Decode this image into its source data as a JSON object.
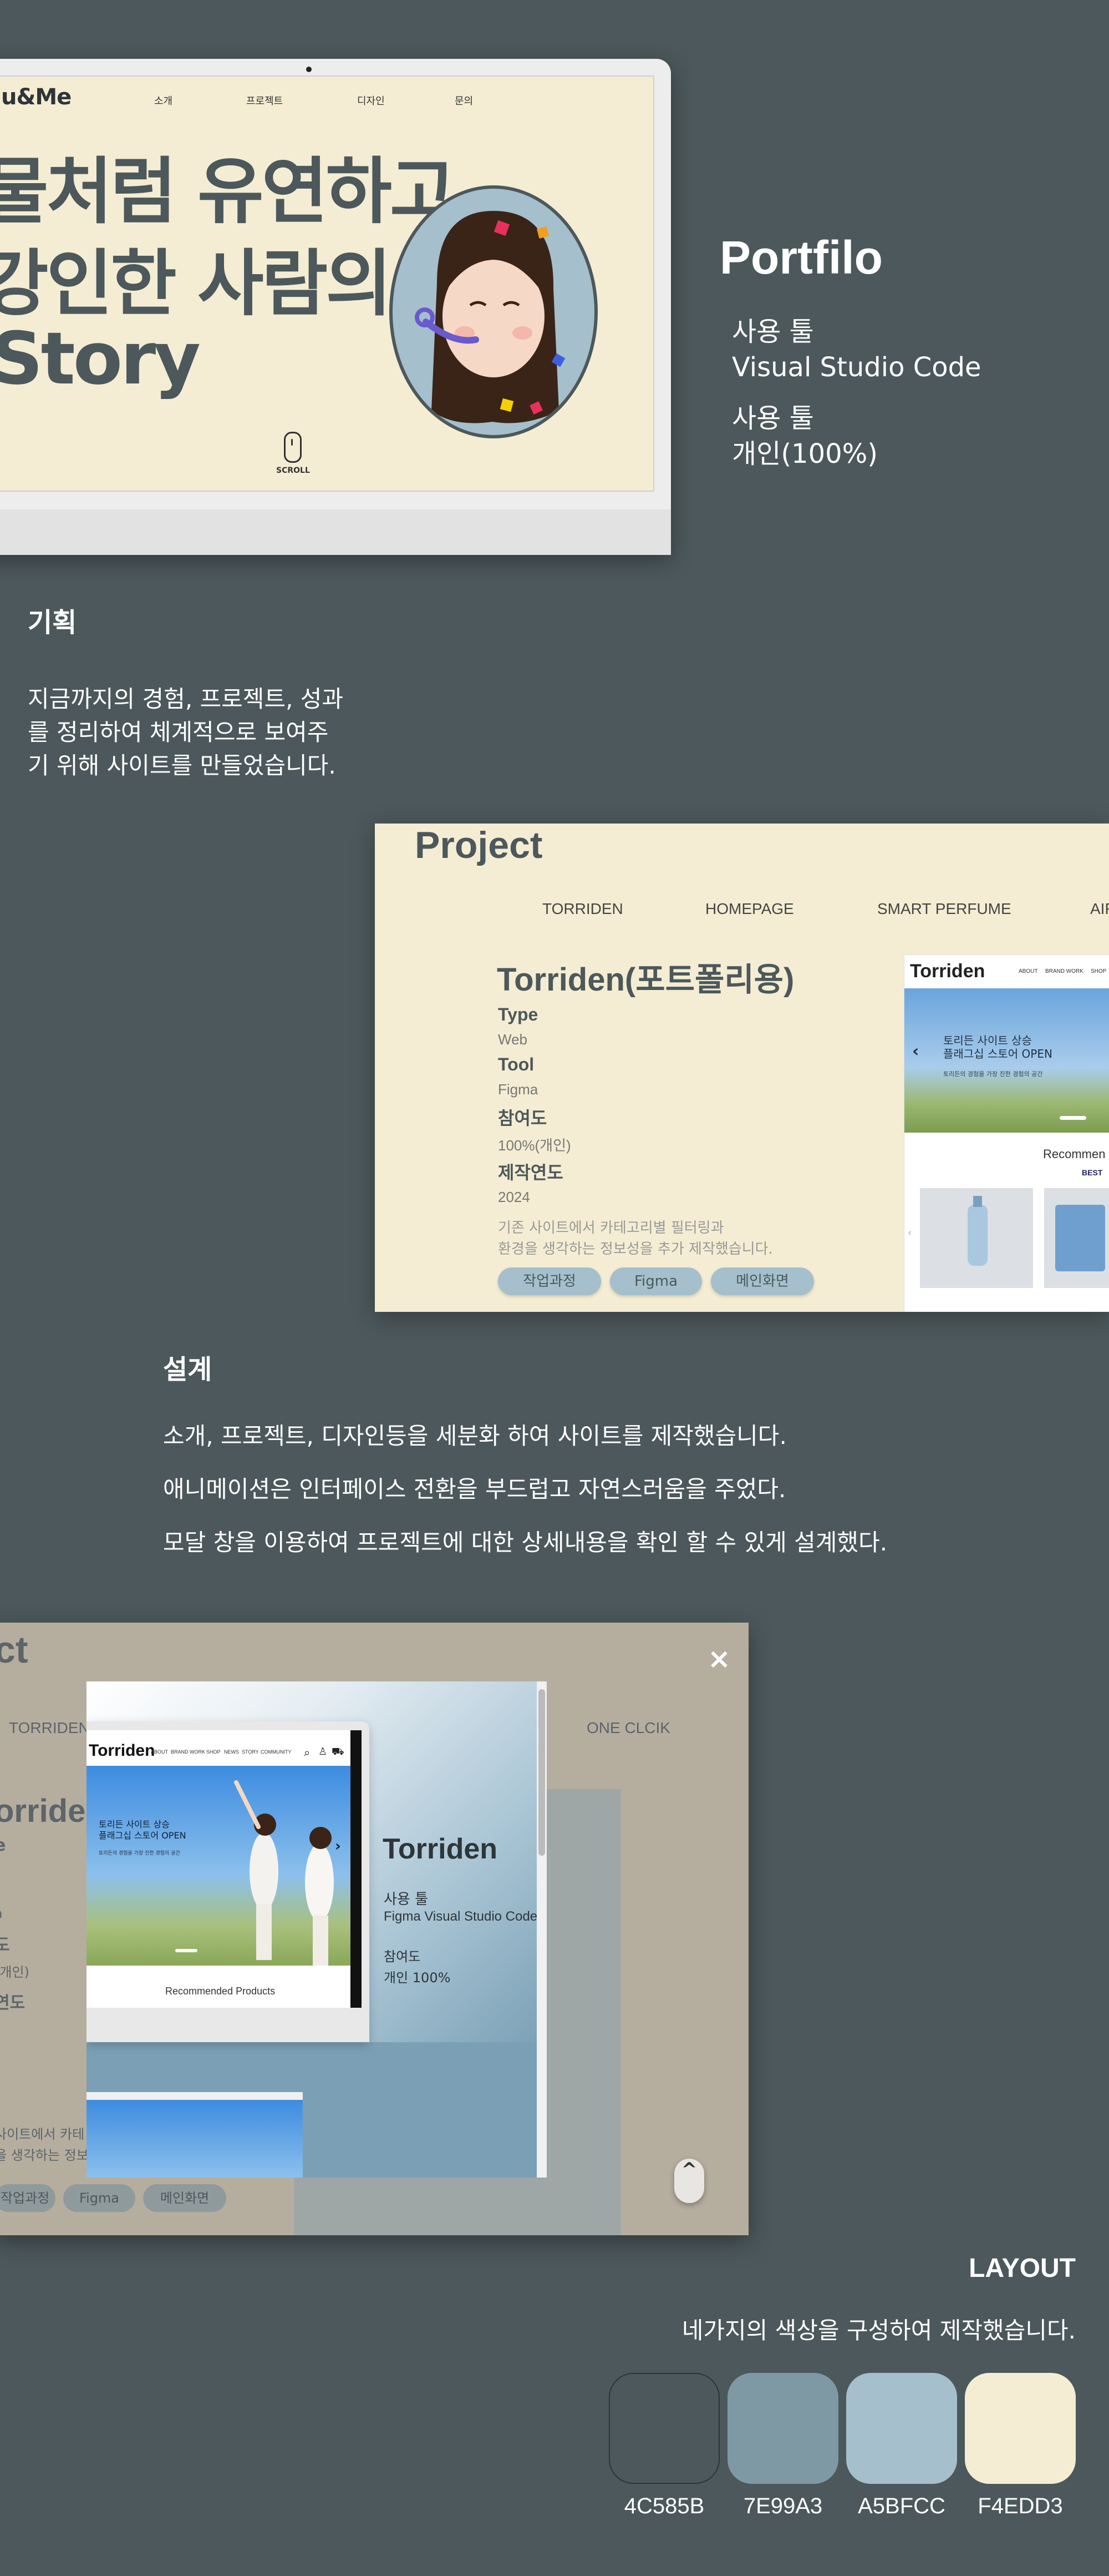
{
  "hero": {
    "logo": "u&Me",
    "nav": [
      "소개",
      "프로젝트",
      "디자인",
      "문의"
    ],
    "lines": [
      "물처럼 유연하고",
      "강인한 사람의",
      "Story"
    ],
    "scroll_label": "SCROLL"
  },
  "portfolio": {
    "title": "Portfilo",
    "info": [
      {
        "label": "사용 툴",
        "value": "Visual Studio Code"
      },
      {
        "label": "사용 툴",
        "value": "개인(100%)"
      }
    ]
  },
  "planning": {
    "heading": "기획",
    "lines": [
      "지금까지의 경험, 프로젝트, 성과",
      "를 정리하여 체계적으로 보여주",
      "기 위해 사이트를 만들었습니다."
    ]
  },
  "project_card": {
    "title": "Project",
    "tabs": [
      "TORRIDEN",
      "HOMEPAGE",
      "SMART PERFUME",
      "AIR"
    ],
    "project_title": "Torriden(포트폴리용)",
    "fields": [
      {
        "key": "Type",
        "value": "Web"
      },
      {
        "key": "Tool",
        "value": "Figma"
      },
      {
        "key": "참여도",
        "value": "100%(개인)"
      },
      {
        "key": "제작연도",
        "value": "2024"
      }
    ],
    "desc": [
      "기존 사이트에서 카테고리별 필터링과",
      "환경을 생각하는 정보성을 추가 제작했습니다."
    ],
    "buttons": [
      "작업과정",
      "Figma",
      "메인화면"
    ],
    "preview": {
      "brand": "Torriden",
      "nav": [
        "ABOUT",
        "BRAND WORK",
        "SHOP"
      ],
      "banner_line1": "토리든 사이트 상승",
      "banner_line2": "플래그십 스토어 OPEN",
      "banner_sub": "토리든의 경험을 가장 진한 경험의 공간",
      "section": "Recommen",
      "badge": "BEST"
    }
  },
  "design": {
    "heading": "설계",
    "lines": [
      "소개, 프로젝트, 디자인등을 세분화 하여 사이트를 제작했습니다.",
      "애니메이션은 인터페이스 전환을 부드럽고 자연스러움을 주었다.",
      "모달 창을 이용하여 프로젝트에 대한 상세내용을 확인 할 수 있게 설계했다."
    ]
  },
  "modal_shot": {
    "bg_title": "ct",
    "bg_tabs": [
      "TORRIDEN",
      "ONE CLCIK"
    ],
    "bg_ptitle": "orriden(",
    "bg_fields": [
      "e",
      "l",
      "a",
      "도",
      "(개인)",
      "연도"
    ],
    "bg_desc": [
      "사이트에서 카테",
      "을 생각하는 정보"
    ],
    "bg_buttons": [
      "작업과정",
      "Figma",
      "메인화면"
    ],
    "close_label": "×",
    "up_label": "^",
    "device": {
      "brand": "Torriden",
      "nav": [
        "ABOUT",
        "BRAND WORK",
        "SHOP",
        "NEWS",
        "STORY",
        "COMMUNITY"
      ],
      "banner_line1": "토리든 사이트 상승",
      "banner_line2": "플래그십 스토어 OPEN",
      "banner_sub": "토리든의 경험을 가장 진한 경험의 공간",
      "section": "Recommended Products"
    },
    "info": {
      "title": "Torriden",
      "tool_label": "사용 툴",
      "tool_value": "Figma Visual Studio Code",
      "part_label": "참여도",
      "part_value": "개인 100%"
    }
  },
  "layout": {
    "title": "LAYOUT",
    "subtitle": "네가지의 색상을 구성하여 제작했습니다.",
    "swatches": [
      {
        "hex": "#4C585B",
        "label": "4C585B"
      },
      {
        "hex": "#7E99A3",
        "label": "7E99A3"
      },
      {
        "hex": "#A5BFCC",
        "label": "A5BFCC"
      },
      {
        "hex": "#F4EDD3",
        "label": "F4EDD3"
      }
    ]
  }
}
